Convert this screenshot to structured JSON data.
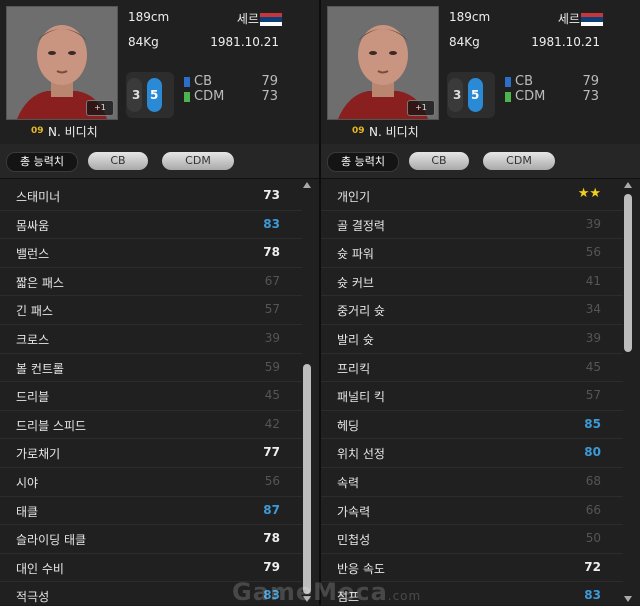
{
  "colors": {
    "cb": "#2b6fc8",
    "cdm": "#4db34d",
    "blue_value": "#3c9ad8",
    "star": "#f2cf1a"
  },
  "panels": [
    {
      "player": {
        "height": "189cm",
        "weight": "84Kg",
        "nationality": "세르비아",
        "birthdate": "1981.10.21",
        "number": "09",
        "name": "N. 비디치",
        "plus_badge": "+1",
        "foot_left": "3",
        "foot_right": "5",
        "positions": [
          {
            "name": "CB",
            "value": "79"
          },
          {
            "name": "CDM",
            "value": "73"
          }
        ]
      },
      "tabs": [
        {
          "label": "총 능력치"
        },
        {
          "label": "CB"
        },
        {
          "label": "CDM"
        }
      ],
      "stats": [
        {
          "label": "스태미너",
          "value": "73"
        },
        {
          "label": "몸싸움",
          "value": "83"
        },
        {
          "label": "밸런스",
          "value": "78"
        },
        {
          "label": "짧은 패스",
          "value": "67"
        },
        {
          "label": "긴 패스",
          "value": "57"
        },
        {
          "label": "크로스",
          "value": "39"
        },
        {
          "label": "볼 컨트롤",
          "value": "59"
        },
        {
          "label": "드리블",
          "value": "45"
        },
        {
          "label": "드리블 스피드",
          "value": "42"
        },
        {
          "label": "가로채기",
          "value": "77"
        },
        {
          "label": "시야",
          "value": "56"
        },
        {
          "label": "태클",
          "value": "87"
        },
        {
          "label": "슬라이딩 태클",
          "value": "78"
        },
        {
          "label": "대인 수비",
          "value": "79"
        },
        {
          "label": "적극성",
          "value": "83"
        }
      ]
    },
    {
      "player": {
        "height": "189cm",
        "weight": "84Kg",
        "nationality": "세르비아",
        "birthdate": "1981.10.21",
        "number": "09",
        "name": "N. 비디치",
        "plus_badge": "+1",
        "foot_left": "3",
        "foot_right": "5",
        "positions": [
          {
            "name": "CB",
            "value": "79"
          },
          {
            "name": "CDM",
            "value": "73"
          }
        ]
      },
      "tabs": [
        {
          "label": "총 능력치"
        },
        {
          "label": "CB"
        },
        {
          "label": "CDM"
        }
      ],
      "stats": [
        {
          "label": "개인기",
          "value": "★★"
        },
        {
          "label": "골 결정력",
          "value": "39"
        },
        {
          "label": "슛 파워",
          "value": "56"
        },
        {
          "label": "슛 커브",
          "value": "41"
        },
        {
          "label": "중거리 슛",
          "value": "34"
        },
        {
          "label": "발리 슛",
          "value": "39"
        },
        {
          "label": "프리킥",
          "value": "45"
        },
        {
          "label": "패널티 킥",
          "value": "57"
        },
        {
          "label": "헤딩",
          "value": "85"
        },
        {
          "label": "위치 선정",
          "value": "80"
        },
        {
          "label": "속력",
          "value": "68"
        },
        {
          "label": "가속력",
          "value": "66"
        },
        {
          "label": "민첩성",
          "value": "50"
        },
        {
          "label": "반응 속도",
          "value": "72"
        },
        {
          "label": "점프",
          "value": "83"
        }
      ]
    }
  ],
  "watermark": {
    "brand": "GameMeca",
    "suffix": ".com"
  }
}
